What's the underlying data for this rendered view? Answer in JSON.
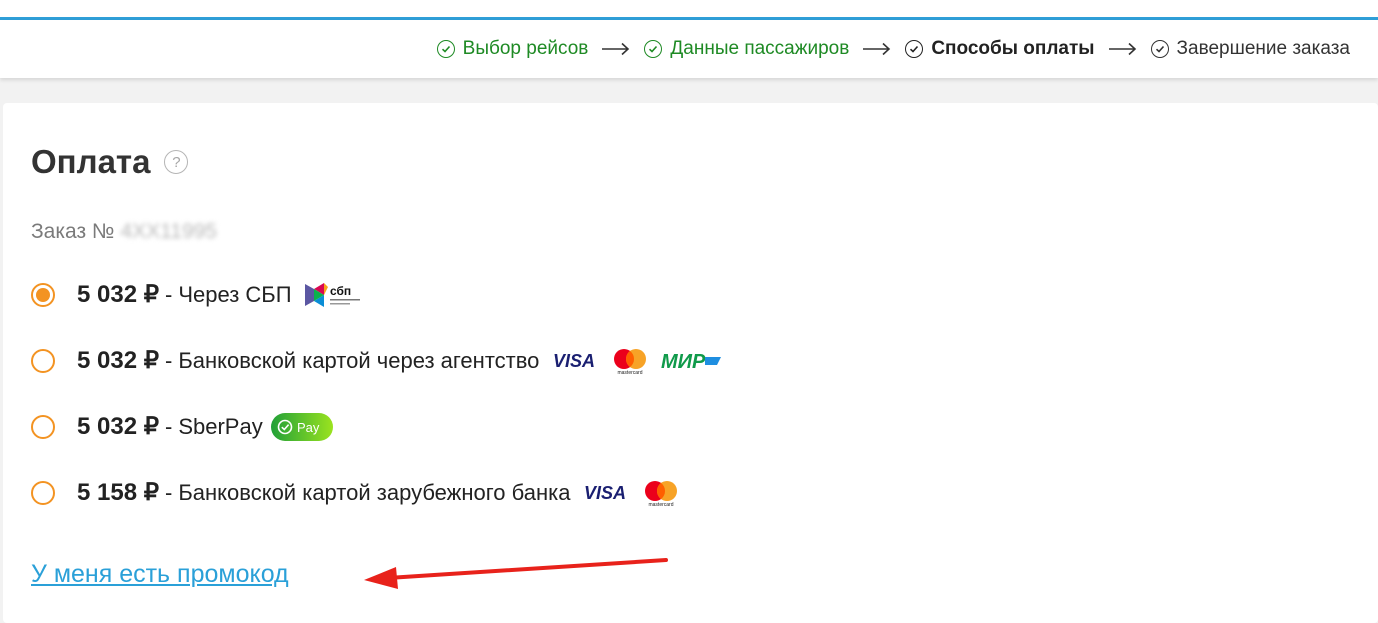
{
  "steps": [
    {
      "label": "Выбор рейсов",
      "state": "done"
    },
    {
      "label": "Данные пассажиров",
      "state": "done"
    },
    {
      "label": "Способы оплаты",
      "state": "current"
    },
    {
      "label": "Завершение заказа",
      "state": "next"
    }
  ],
  "payment": {
    "title": "Оплата",
    "help_glyph": "?",
    "order_label": "Заказ №",
    "order_number": "4ХХ11995",
    "separator": "-",
    "options": [
      {
        "price": "5 032 ₽",
        "method": "Через СБП",
        "selected": true,
        "logos": [
          "sbp-logo"
        ],
        "sbp_text": "сбп"
      },
      {
        "price": "5 032 ₽",
        "method": "Банковской картой через агентство",
        "selected": false,
        "logos": [
          "visa-logo",
          "mastercard-logo",
          "mir-logo"
        ],
        "visa_text": "VISA",
        "mc_text": "mastercard",
        "mir_text": "МИР"
      },
      {
        "price": "5 032 ₽",
        "method": "SberPay",
        "selected": false,
        "logos": [
          "sberpay-logo"
        ],
        "pay_text": "Pay"
      },
      {
        "price": "5 158 ₽",
        "method": "Банковской картой зарубежного банка",
        "selected": false,
        "logos": [
          "visa-logo",
          "mastercard-logo"
        ],
        "visa_text": "VISA",
        "mc_text": "mastercard"
      }
    ],
    "promo_link": "У меня есть промокод"
  },
  "colors": {
    "accent_orange": "#f39322",
    "done_green": "#1e8a24",
    "link_blue": "#2aa0d8",
    "top_line_blue": "#2f9fd8",
    "annotation_red": "#e8221b"
  }
}
